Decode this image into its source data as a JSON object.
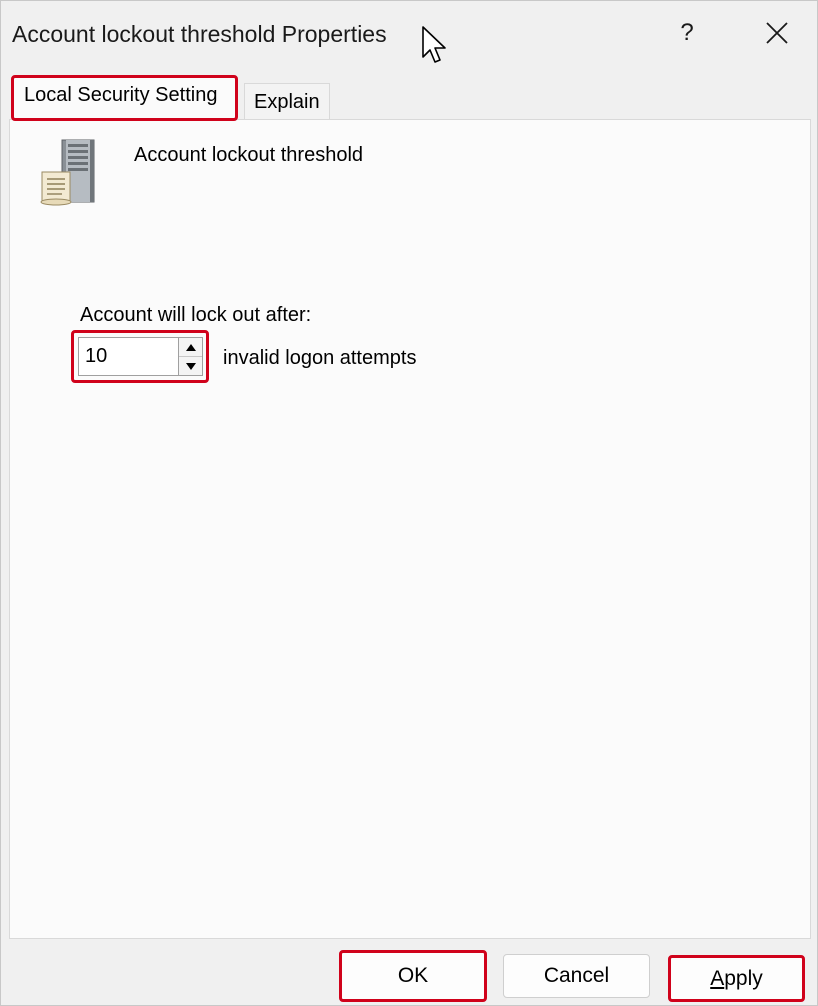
{
  "window": {
    "title": "Account lockout threshold Properties",
    "help_label": "?",
    "close_icon": "close-icon"
  },
  "tabs": [
    {
      "label": "Local Security Setting",
      "selected": true
    },
    {
      "label": "Explain",
      "selected": false
    }
  ],
  "setting": {
    "policy_icon": "server-policy-icon",
    "policy_name": "Account lockout threshold",
    "lock_label": "Account will lock out after:",
    "threshold_value": "10",
    "suffix_label": "invalid logon attempts"
  },
  "buttons": {
    "ok": "OK",
    "cancel": "Cancel",
    "apply_mnemonic": "A",
    "apply_rest": "pply"
  },
  "colors": {
    "highlight": "#d0021b",
    "background": "#f0f0f0",
    "panel": "#fbfbfb"
  }
}
